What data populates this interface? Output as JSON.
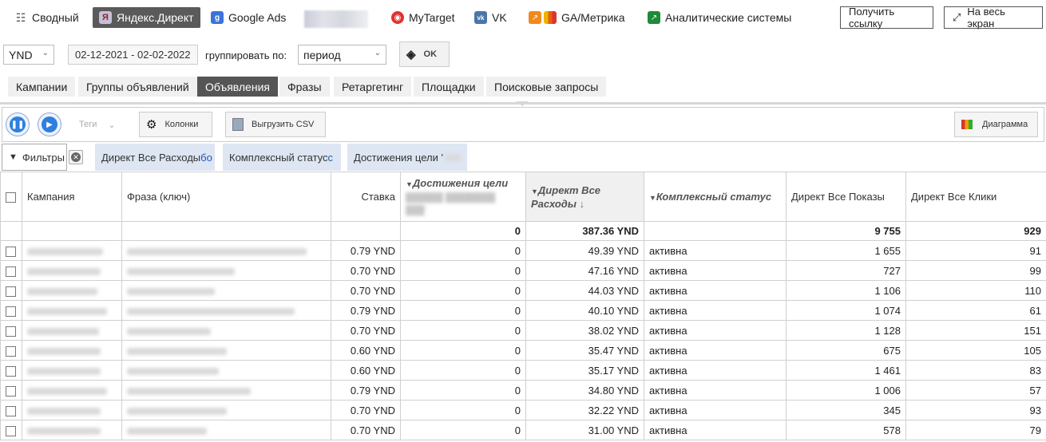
{
  "nav": {
    "items": [
      {
        "label": "Сводный",
        "icon": "coins-icon"
      },
      {
        "label": "Яндекс.Директ",
        "icon": "yandex-icon"
      },
      {
        "label": "Google Ads",
        "icon": "google-icon"
      },
      {
        "label": "MyTarget",
        "icon": "mytarget-icon"
      },
      {
        "label": "VK",
        "icon": "vk-icon"
      },
      {
        "label": "GA/Метрика",
        "icon": "analytics-icon"
      },
      {
        "label": "Аналитические системы",
        "icon": "chart-icon"
      }
    ],
    "get_link": "Получить ссылку",
    "fullscreen": "На весь экран"
  },
  "filters": {
    "currency": "YND",
    "date_range": "02-12-2021 - 02-02-2022",
    "group_label": "группировать по:",
    "group_value": "период",
    "ok": "OK"
  },
  "tabs": [
    "Кампании",
    "Группы объявлений",
    "Объявления",
    "Фразы",
    "Ретаргетинг",
    "Площадки",
    "Поисковые запросы"
  ],
  "toolbar": {
    "tags": "Теги",
    "columns": "Колонки",
    "export": "Выгрузить CSV",
    "chart": "Диаграмма"
  },
  "chips": {
    "filters": "Фильтры",
    "c1": "Директ Все Расходы ",
    "c1_hl": "бо",
    "c2": "Комплексный статус ",
    "c2_hl": "с",
    "c3": "Достижения цели '"
  },
  "table": {
    "headers": {
      "campaign": "Кампания",
      "phrase": "Фраза (ключ)",
      "bid": "Ставка",
      "goals": "Достижения цели",
      "spend": "Директ Все Расходы",
      "status": "Комплексный статус",
      "impressions": "Директ Все Показы",
      "clicks": "Директ Все Клики"
    },
    "total": {
      "goals": "0",
      "spend": "387.36 YND",
      "impressions": "9 755",
      "clicks": "929"
    },
    "rows": [
      {
        "bid": "0.79 YND",
        "goals": "0",
        "spend": "49.39 YND",
        "status": "активна",
        "impressions": "1 655",
        "clicks": "91"
      },
      {
        "bid": "0.70 YND",
        "goals": "0",
        "spend": "47.16 YND",
        "status": "активна",
        "impressions": "727",
        "clicks": "99"
      },
      {
        "bid": "0.70 YND",
        "goals": "0",
        "spend": "44.03 YND",
        "status": "активна",
        "impressions": "1 106",
        "clicks": "110"
      },
      {
        "bid": "0.79 YND",
        "goals": "0",
        "spend": "40.10 YND",
        "status": "активна",
        "impressions": "1 074",
        "clicks": "61"
      },
      {
        "bid": "0.70 YND",
        "goals": "0",
        "spend": "38.02 YND",
        "status": "активна",
        "impressions": "1 128",
        "clicks": "151"
      },
      {
        "bid": "0.60 YND",
        "goals": "0",
        "spend": "35.47 YND",
        "status": "активна",
        "impressions": "675",
        "clicks": "105"
      },
      {
        "bid": "0.60 YND",
        "goals": "0",
        "spend": "35.17 YND",
        "status": "активна",
        "impressions": "1 461",
        "clicks": "83"
      },
      {
        "bid": "0.79 YND",
        "goals": "0",
        "spend": "34.80 YND",
        "status": "активна",
        "impressions": "1 006",
        "clicks": "57"
      },
      {
        "bid": "0.70 YND",
        "goals": "0",
        "spend": "32.22 YND",
        "status": "активна",
        "impressions": "345",
        "clicks": "93"
      },
      {
        "bid": "0.70 YND",
        "goals": "0",
        "spend": "31.00 YND",
        "status": "активна",
        "impressions": "578",
        "clicks": "79"
      }
    ]
  }
}
